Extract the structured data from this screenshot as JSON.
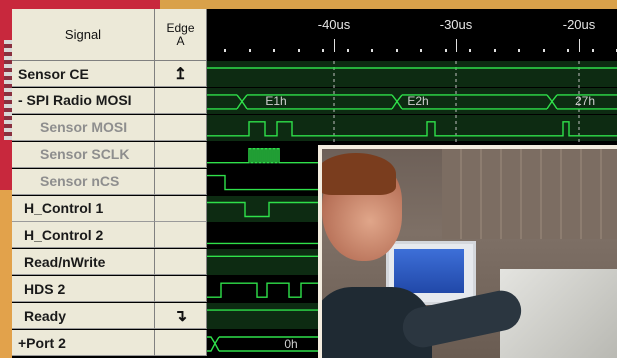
{
  "header": {
    "signal_col": "Signal",
    "edge_col_line1": "Edge",
    "edge_col_line2": "A"
  },
  "time_ruler": {
    "labels": [
      "-40us",
      "-30us",
      "-20us"
    ]
  },
  "signals": [
    {
      "name": "Sensor CE",
      "edge": "↥",
      "sub": false,
      "first": true
    },
    {
      "name": "- SPI Radio MOSI",
      "edge": "",
      "sub": false,
      "first": true
    },
    {
      "name": "Sensor MOSI",
      "edge": "",
      "sub": true
    },
    {
      "name": "Sensor SCLK",
      "edge": "",
      "sub": true
    },
    {
      "name": "Sensor nCS",
      "edge": "",
      "sub": true
    },
    {
      "name": "H_Control 1",
      "edge": "",
      "sub": false
    },
    {
      "name": "H_Control 2",
      "edge": "",
      "sub": false
    },
    {
      "name": "Read/nWrite",
      "edge": "",
      "sub": false
    },
    {
      "name": "HDS 2",
      "edge": "",
      "sub": false
    },
    {
      "name": "Ready",
      "edge": "↴",
      "sub": false
    },
    {
      "name": "+Port 2",
      "edge": "",
      "sub": false,
      "first": true
    }
  ],
  "bus_values": {
    "spi_bytes": [
      "E1h",
      "E2h",
      "27h"
    ],
    "port2_value": "0h"
  },
  "colors": {
    "wave_green": "#2fe04a",
    "row_dark_green": "#0d2b12",
    "grid_dashed": "#bfbfbf"
  }
}
